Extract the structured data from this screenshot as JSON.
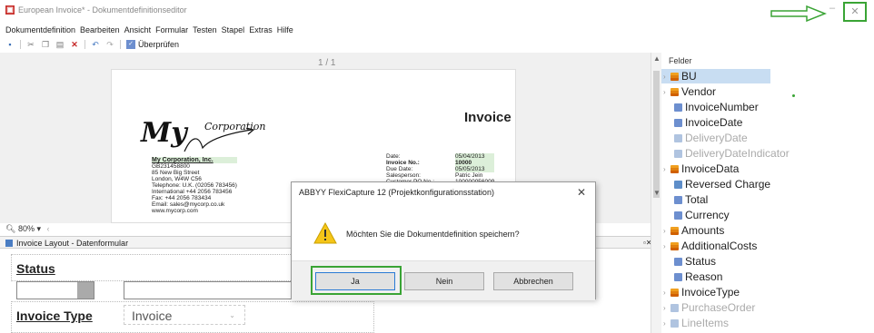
{
  "window": {
    "title": "European Invoice* - Dokumentdefinitionseditor",
    "minimize": "–",
    "close": "✕"
  },
  "menu": [
    "Dokumentdefinition",
    "Bearbeiten",
    "Ansicht",
    "Formular",
    "Testen",
    "Stapel",
    "Extras",
    "Hilfe"
  ],
  "toolbar": {
    "check_label": "Überprüfen"
  },
  "document": {
    "page_indicator": "1 / 1",
    "zoom": "80%",
    "logo_main": "My",
    "logo_sub": "Corporation",
    "company_lines": [
      "My Corporation, Inc.",
      "GB231458800",
      "85 New Big Street",
      "London, W4W C56",
      "Telephone: U.K. (02056 783456)",
      "International +44 2056 783456",
      "Fax: +44 2056 783434",
      "Email: sales@mycorp.co.uk",
      "www.mycorp.com"
    ],
    "invoice_title": "Invoice",
    "invoice_labels": [
      "Date:",
      "Invoice No.:",
      "Due Date:",
      "Salesperson:",
      "Customer PO No.:"
    ],
    "invoice_values": [
      "05/04/2013",
      "10000",
      "05/05/2013",
      "Patric Jein",
      "100000056009"
    ]
  },
  "dataform": {
    "title": "Invoice Layout - Datenformular",
    "status_label": "Status",
    "invoice_type_label": "Invoice Type",
    "invoice_type_value": "Invoice"
  },
  "fields_panel": {
    "header": "Felder",
    "items": [
      {
        "label": "BU",
        "icon": "group-icon",
        "selected": true,
        "dim": false,
        "indent": 0
      },
      {
        "label": "Vendor",
        "icon": "group-icon",
        "selected": false,
        "dim": false,
        "indent": 0
      },
      {
        "label": "InvoiceNumber",
        "icon": "field-icon",
        "selected": false,
        "dim": false,
        "indent": 1
      },
      {
        "label": "InvoiceDate",
        "icon": "field-icon",
        "selected": false,
        "dim": false,
        "indent": 1
      },
      {
        "label": "DeliveryDate",
        "icon": "field-icon",
        "selected": false,
        "dim": true,
        "indent": 1
      },
      {
        "label": "DeliveryDateIndicator",
        "icon": "checkbox-icon",
        "selected": false,
        "dim": true,
        "indent": 1
      },
      {
        "label": "InvoiceData",
        "icon": "group-icon",
        "selected": false,
        "dim": false,
        "indent": 0
      },
      {
        "label": "Reversed Charge",
        "icon": "checkbox-icon",
        "selected": false,
        "dim": false,
        "indent": 1
      },
      {
        "label": "Total",
        "icon": "field-icon",
        "selected": false,
        "dim": false,
        "indent": 1
      },
      {
        "label": "Currency",
        "icon": "field-icon",
        "selected": false,
        "dim": false,
        "indent": 1
      },
      {
        "label": "Amounts",
        "icon": "group-icon",
        "selected": false,
        "dim": false,
        "indent": 0
      },
      {
        "label": "AdditionalCosts",
        "icon": "group-icon",
        "selected": false,
        "dim": false,
        "indent": 0
      },
      {
        "label": "Status",
        "icon": "field-icon",
        "selected": false,
        "dim": false,
        "indent": 1
      },
      {
        "label": "Reason",
        "icon": "field-icon",
        "selected": false,
        "dim": false,
        "indent": 1
      },
      {
        "label": "InvoiceType",
        "icon": "group-icon",
        "selected": false,
        "dim": false,
        "indent": 0
      },
      {
        "label": "PurchaseOrder",
        "icon": "group-icon",
        "selected": false,
        "dim": true,
        "indent": 0
      },
      {
        "label": "LineItems",
        "icon": "group-icon",
        "selected": false,
        "dim": true,
        "indent": 0
      }
    ]
  },
  "dialog": {
    "title": "ABBYY FlexiCapture 12 (Projektkonfigurationsstation)",
    "message": "Möchten Sie die Dokumentdefinition speichern?",
    "buttons": {
      "yes": "Ja",
      "no": "Nein",
      "cancel": "Abbrechen"
    }
  },
  "colors": {
    "annotation_green": "#3aa435",
    "selection_blue": "#c8ddf2",
    "warning_yellow": "#f5c518"
  }
}
